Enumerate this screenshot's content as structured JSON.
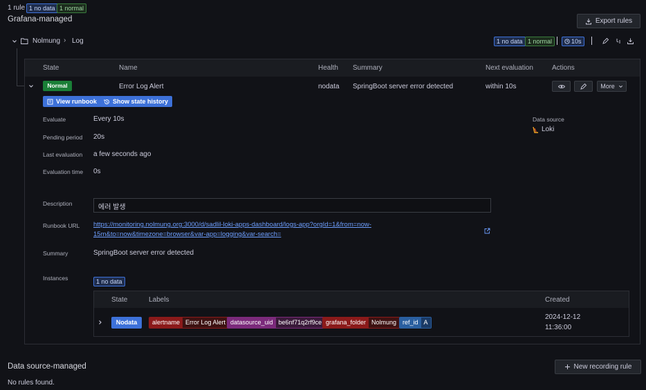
{
  "header": {
    "rule_count": "1 rule",
    "nodata_badge": "1 no data",
    "normal_badge": "1 normal",
    "section_title": "Grafana-managed",
    "export_label": "Export rules"
  },
  "folder": {
    "name": "Nolmung",
    "group": "Log",
    "nodata_badge": "1 no data",
    "normal_badge": "1 normal",
    "interval": "10s"
  },
  "table": {
    "headers": {
      "state": "State",
      "name": "Name",
      "health": "Health",
      "summary": "Summary",
      "next": "Next evaluation",
      "actions": "Actions"
    },
    "row": {
      "state": "Normal",
      "name": "Error Log Alert",
      "health": "nodata",
      "summary": "SpringBoot server error detected",
      "next": "within 10s",
      "more_label": "More"
    }
  },
  "detail": {
    "view_runbook": "View runbook",
    "show_history": "Show state history",
    "evaluate_label": "Evaluate",
    "evaluate_value": "Every 10s",
    "pending_label": "Pending period",
    "pending_value": "20s",
    "last_label": "Last evaluation",
    "last_value": "a few seconds ago",
    "evaltime_label": "Evaluation time",
    "evaltime_value": "0s",
    "datasource_label": "Data source",
    "datasource_value": "Loki",
    "description_label": "Description",
    "description_value": "에러 발생",
    "runbook_label": "Runbook URL",
    "runbook_line1": "https://monitoring.nolmung.org:3000/d/sadlil-loki-apps-dashboard/logs-app?orgId=1&from=now-",
    "runbook_line2": "15m&to=now&timezone=browser&var-app=logging&var-search=",
    "summary_label": "Summary",
    "summary_value": "SpringBoot server error detected",
    "instances_label": "Instances",
    "instances_badge": "1 no data"
  },
  "instances": {
    "headers": {
      "state": "State",
      "labels": "Labels",
      "created": "Created"
    },
    "row": {
      "state": "Nodata",
      "created_date": "2024-12-12",
      "created_time": "11:36:00",
      "labels": [
        {
          "key": "alertname",
          "value": "Error Log Alert"
        },
        {
          "key": "datasource_uid",
          "value": "be6nf71q2rf9ce"
        },
        {
          "key": "grafana_folder",
          "value": "Nolmung"
        },
        {
          "key": "ref_id",
          "value": "A"
        }
      ]
    }
  },
  "datasource_section": {
    "title": "Data source-managed",
    "new_rule_label": "New recording rule",
    "empty": "No rules found."
  },
  "colors": {
    "background": "#111217",
    "accent_blue": "#3d71d9",
    "normal_green": "#1a7f37",
    "label_red": "#8b1a1a",
    "label_purple": "#7b2a7b",
    "label_blue": "#2a5fa0"
  }
}
